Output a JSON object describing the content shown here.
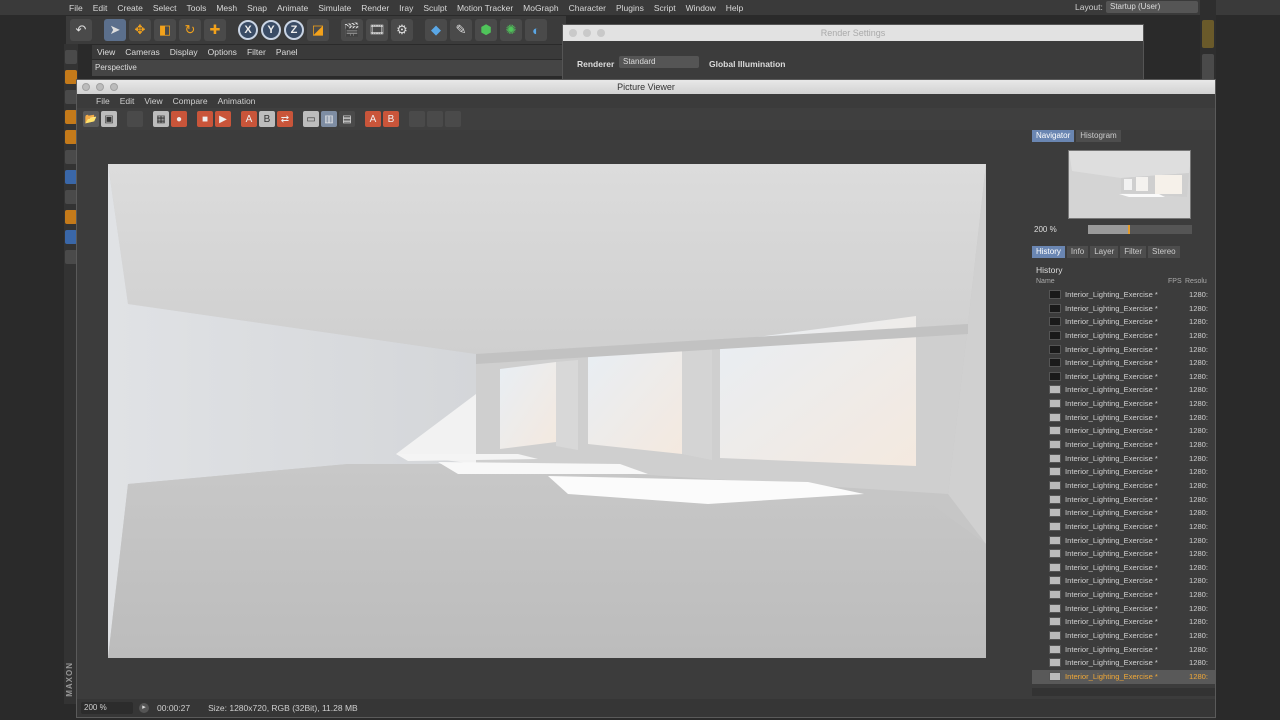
{
  "menubar": {
    "items": [
      "File",
      "Edit",
      "Create",
      "Select",
      "Tools",
      "Mesh",
      "Snap",
      "Animate",
      "Simulate",
      "Render",
      "Iray",
      "Sculpt",
      "Motion Tracker",
      "MoGraph",
      "Character",
      "Plugins",
      "Script",
      "Window",
      "Help"
    ],
    "layout_label": "Layout:",
    "layout_value": "Startup (User)"
  },
  "toolbar": {
    "axis_x": "X",
    "axis_y": "Y",
    "axis_z": "Z"
  },
  "viewport": {
    "menu": [
      "View",
      "Cameras",
      "Display",
      "Options",
      "Filter",
      "Panel"
    ],
    "camera": "Perspective"
  },
  "render_settings": {
    "title": "Render Settings",
    "renderer_label": "Renderer",
    "renderer_value": "Standard",
    "section": "Global Illumination"
  },
  "picture_viewer": {
    "title": "Picture Viewer",
    "menu": [
      "File",
      "Edit",
      "View",
      "Compare",
      "Animation"
    ],
    "status": {
      "zoom": "200 %",
      "time": "00:00:27",
      "size_info": "Size: 1280x720, RGB (32Bit), 11.28 MB"
    }
  },
  "navigator": {
    "tabs": [
      "Navigator",
      "Histogram"
    ],
    "zoom": "200 %",
    "zoom_fraction": 0.4
  },
  "history": {
    "tabs": [
      "History",
      "Info",
      "Layer",
      "Filter",
      "Stereo"
    ],
    "header": "History",
    "col_name": "Name",
    "col_fps": "FPS",
    "col_res": "Resolu",
    "item_name": "Interior_Lighting_Exercise *",
    "item_res": "1280:",
    "count": 29
  },
  "maxon": "MAXON"
}
